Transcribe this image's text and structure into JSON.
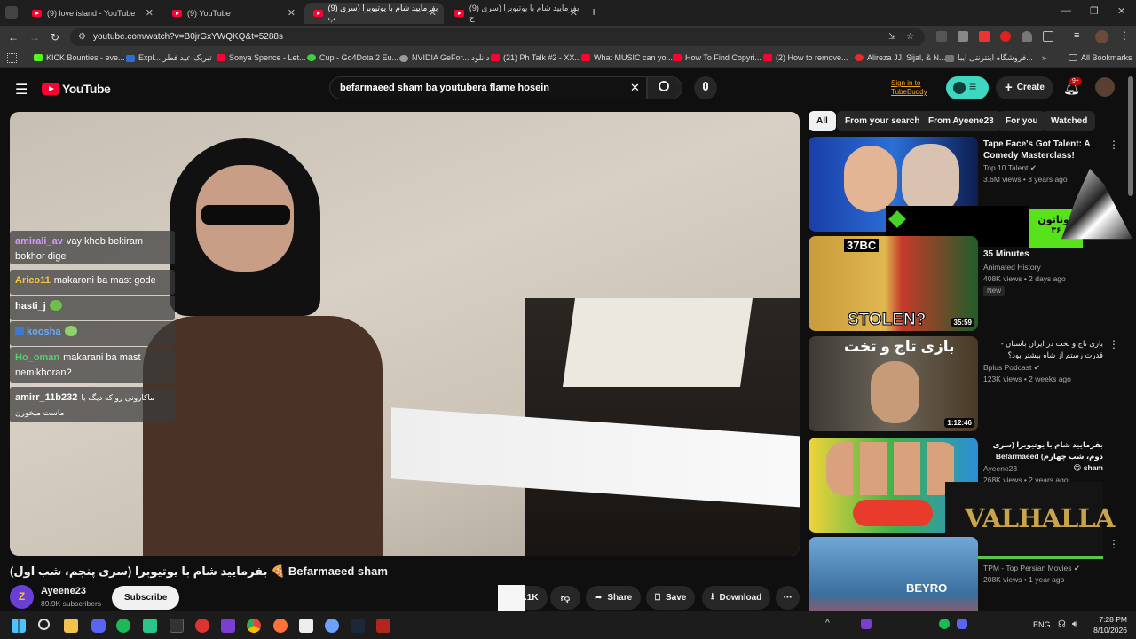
{
  "browser": {
    "tabs": [
      {
        "label": "(9) love island - YouTube",
        "active": false
      },
      {
        "label": "(9) YouTube",
        "active": false
      },
      {
        "label": "(9) بفرمایید شام با یوتیوبرا (سری پ",
        "active": true
      },
      {
        "label": "(9) بفرمایید شام با یوتیوبرا (سری ج",
        "active": false
      }
    ],
    "new_tab": "+",
    "url": "youtube.com/watch?v=B0jrGxYWQKQ&t=5288s",
    "bookmarks": [
      "KICK Bounties - eve...",
      "Expl... تبریک عید فطر",
      "Sonya Spence - Let...",
      "Cup - Go4Dota 2 Eu...",
      "NVIDIA GeFor... دانلود",
      "(21) Ph Talk #2 - XX...",
      "What MUSIC can yo...",
      "How To Find Copyri...",
      "(2) How to remove...",
      "Alireza JJ, Sijal, & N...",
      "فروشگاه اینترنتی ایبا...",
      "All Bookmarks"
    ],
    "bookmark_colors": [
      "#53fc18",
      "#2b6fd6",
      "#ff0033",
      "#3ecf3e",
      "#555",
      "#ff0033",
      "#ff0033",
      "#ff0033",
      "#ff0033",
      "#e52b2b",
      "#777",
      "#aaa"
    ]
  },
  "youtube": {
    "logo": "YouTube",
    "search_value": "befarmaeed sham ba youtubera flame hosein",
    "signin": "Sign in to TubeBuddy",
    "create": "Create",
    "notif_badge": "9+"
  },
  "chat": [
    {
      "user": "amirali_av",
      "text": "vay khob bekiram bokhor dige",
      "color": "#d79bff"
    },
    {
      "user": "Arico11",
      "text": "makaroni ba mast gode",
      "color": "#f5c542"
    },
    {
      "user": "hasti_j",
      "text": "",
      "color": "#ffffff"
    },
    {
      "user": "koosha",
      "text": "",
      "color": "#66aaff"
    },
    {
      "user": "Ho_oman",
      "text": "makarani ba mast nemikhoran?",
      "color": "#4fd36b"
    },
    {
      "user": "amirr_11b232",
      "text": "ماکارونی رو که دیگه با ماست میخورن",
      "color": "#ffffff"
    }
  ],
  "video": {
    "title": "بفرمایید شام با یوتیوبرا (سری پنجم، شب اول) 🍕 Befarmaeed sham",
    "channel": "Ayeene23",
    "subs": "89.9K subscribers",
    "subscribe": "Subscribe",
    "likes": ".1K",
    "share": "Share",
    "save": "Save",
    "download": "Download"
  },
  "chips": [
    "All",
    "From your search",
    "From Ayeene23",
    "For you",
    "Watched"
  ],
  "related": [
    {
      "title": "Tape Face's Got Talent: A Comedy Masterclass!",
      "channel": "Top 10 Talent",
      "meta": "3.6M views • 3 years ago",
      "duration": "",
      "badge": ""
    },
    {
      "title": "35 Minutes",
      "channel": "Animated History",
      "meta": "408K views • 2 days ago",
      "duration": "35:59",
      "badge": "New"
    },
    {
      "title": "بازی تاج و تخت در ایران باستان - قدرت رستم از شاه بیشتر بود؟",
      "channel": "Bplus Podcast",
      "meta": "123K views • 2 weeks ago",
      "duration": "1:12:46",
      "badge": ""
    },
    {
      "title": "بفرمایید شام با یوتیوبرا (سری دوم، شب چهارم) Befarmaeed sham 😋",
      "channel": "Ayeene23",
      "meta": "268K views • 2 years ago",
      "duration": "",
      "badge": ""
    },
    {
      "title": "",
      "channel": "TPM - Top Persian Movies",
      "meta": "208K views • 1 year ago",
      "duration": "",
      "badge": ""
    }
  ],
  "thumb_text": [
    "37BC",
    "STOLEN?",
    "بازی تاج و تخت",
    "BEYRO"
  ],
  "overlays": {
    "donation": "دوناتون",
    "donation_sub": "۳۶",
    "valhalla": "VALHALLA"
  },
  "taskbar": {
    "lang": "ENG",
    "time": "7:28 PM",
    "date": "8/10/2026"
  }
}
